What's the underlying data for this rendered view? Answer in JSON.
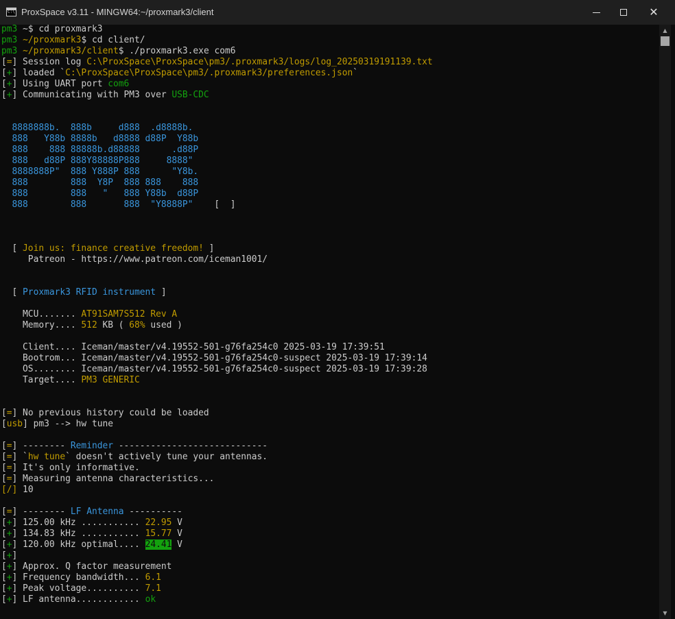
{
  "window": {
    "title": "ProxSpace v3.11 - MINGW64:~/proxmark3/client",
    "icon": "console-icon"
  },
  "colors": {
    "default": "#cccccc",
    "green": "#13a10e",
    "yellow": "#c19c00",
    "blue": "#3a96dd",
    "highlight_bg": "#13a10e",
    "highlight_fg": "#0c0c0c"
  },
  "terminal": {
    "lines": [
      {
        "row": 0,
        "segments": [
          {
            "t": "pm3",
            "c": "green"
          },
          {
            "t": " ~$ cd proxmark3",
            "c": "default"
          }
        ]
      },
      {
        "row": 1,
        "segments": [
          {
            "t": "pm3",
            "c": "green"
          },
          {
            "t": " ",
            "c": "default"
          },
          {
            "t": "~/proxmark3",
            "c": "yellow"
          },
          {
            "t": "$ cd client/",
            "c": "default"
          }
        ]
      },
      {
        "row": 2,
        "segments": [
          {
            "t": "pm3",
            "c": "green"
          },
          {
            "t": " ",
            "c": "default"
          },
          {
            "t": "~/proxmark3/client",
            "c": "yellow"
          },
          {
            "t": "$ ./proxmark3.exe com6",
            "c": "default"
          }
        ]
      },
      {
        "row": 3,
        "segments": [
          {
            "t": "[",
            "c": "default"
          },
          {
            "t": "=",
            "c": "yellow"
          },
          {
            "t": "] Session log ",
            "c": "default"
          },
          {
            "t": "C:\\ProxSpace\\ProxSpace\\pm3/.proxmark3/logs/log_20250319191139.txt",
            "c": "yellow"
          }
        ]
      },
      {
        "row": 4,
        "segments": [
          {
            "t": "[",
            "c": "default"
          },
          {
            "t": "+",
            "c": "green"
          },
          {
            "t": "] loaded `",
            "c": "default"
          },
          {
            "t": "C:\\ProxSpace\\ProxSpace\\pm3/.proxmark3/preferences.json",
            "c": "yellow"
          },
          {
            "t": "`",
            "c": "default"
          }
        ]
      },
      {
        "row": 5,
        "segments": [
          {
            "t": "[",
            "c": "default"
          },
          {
            "t": "+",
            "c": "green"
          },
          {
            "t": "] Using UART port ",
            "c": "default"
          },
          {
            "t": "com6",
            "c": "green"
          }
        ]
      },
      {
        "row": 6,
        "segments": [
          {
            "t": "[",
            "c": "default"
          },
          {
            "t": "+",
            "c": "green"
          },
          {
            "t": "] Communicating with PM3 over ",
            "c": "default"
          },
          {
            "t": "USB-CDC",
            "c": "green"
          }
        ]
      },
      {
        "row": 9,
        "segments": [
          {
            "t": "  8888888b.  888b     d888  .d8888b.",
            "c": "blue"
          }
        ]
      },
      {
        "row": 10,
        "segments": [
          {
            "t": "  888   Y88b 8888b   d8888 d88P  Y88b",
            "c": "blue"
          }
        ]
      },
      {
        "row": 11,
        "segments": [
          {
            "t": "  888    888 88888b.d88888      .d88P",
            "c": "blue"
          }
        ]
      },
      {
        "row": 12,
        "segments": [
          {
            "t": "  888   d88P 888Y88888P888     8888\"",
            "c": "blue"
          }
        ]
      },
      {
        "row": 13,
        "segments": [
          {
            "t": "  8888888P\"  888 Y888P 888      \"Y8b.",
            "c": "blue"
          }
        ]
      },
      {
        "row": 14,
        "segments": [
          {
            "t": "  888        888  Y8P  888 888    888",
            "c": "blue"
          }
        ]
      },
      {
        "row": 15,
        "segments": [
          {
            "t": "  888        888   \"   888 Y88b  d88P",
            "c": "blue"
          }
        ]
      },
      {
        "row": 16,
        "segments": [
          {
            "t": "  888        888       888  \"Y8888P\"",
            "c": "blue"
          },
          {
            "t": "    [  ]",
            "c": "default"
          }
        ]
      },
      {
        "row": 20,
        "segments": [
          {
            "t": "  [ ",
            "c": "default"
          },
          {
            "t": "Join us: finance creative freedom!",
            "c": "yellow"
          },
          {
            "t": " ]",
            "c": "default"
          }
        ]
      },
      {
        "row": 21,
        "segments": [
          {
            "t": "     Patreon - https://www.patreon.com/iceman1001/",
            "c": "default"
          }
        ]
      },
      {
        "row": 24,
        "segments": [
          {
            "t": "  [ ",
            "c": "default"
          },
          {
            "t": "Proxmark3 RFID instrument",
            "c": "blue"
          },
          {
            "t": " ]",
            "c": "default"
          }
        ]
      },
      {
        "row": 26,
        "segments": [
          {
            "t": "    MCU....... ",
            "c": "default"
          },
          {
            "t": "AT91SAM7S512 Rev A",
            "c": "yellow"
          }
        ]
      },
      {
        "row": 27,
        "segments": [
          {
            "t": "    Memory.... ",
            "c": "default"
          },
          {
            "t": "512",
            "c": "yellow"
          },
          {
            "t": " KB ( ",
            "c": "default"
          },
          {
            "t": "68%",
            "c": "yellow"
          },
          {
            "t": " used )",
            "c": "default"
          }
        ]
      },
      {
        "row": 29,
        "segments": [
          {
            "t": "    Client.... Iceman/master/v4.19552-501-g76fa254c0 2025-03-19 17:39:51",
            "c": "default"
          }
        ]
      },
      {
        "row": 30,
        "segments": [
          {
            "t": "    Bootrom... Iceman/master/v4.19552-501-g76fa254c0-suspect 2025-03-19 17:39:14",
            "c": "default"
          }
        ]
      },
      {
        "row": 31,
        "segments": [
          {
            "t": "    OS........ Iceman/master/v4.19552-501-g76fa254c0-suspect 2025-03-19 17:39:28",
            "c": "default"
          }
        ]
      },
      {
        "row": 32,
        "segments": [
          {
            "t": "    Target.... ",
            "c": "default"
          },
          {
            "t": "PM3 GENERIC",
            "c": "yellow"
          }
        ]
      },
      {
        "row": 35,
        "segments": [
          {
            "t": "[",
            "c": "default"
          },
          {
            "t": "=",
            "c": "yellow"
          },
          {
            "t": "] No previous history could be loaded",
            "c": "default"
          }
        ]
      },
      {
        "row": 36,
        "segments": [
          {
            "t": "[",
            "c": "default"
          },
          {
            "t": "usb",
            "c": "yellow"
          },
          {
            "t": "] pm3 --> hw tune",
            "c": "default"
          }
        ]
      },
      {
        "row": 38,
        "segments": [
          {
            "t": "[",
            "c": "default"
          },
          {
            "t": "=",
            "c": "yellow"
          },
          {
            "t": "] -------- ",
            "c": "default"
          },
          {
            "t": "Reminder",
            "c": "blue"
          },
          {
            "t": " ----------------------------",
            "c": "default"
          }
        ]
      },
      {
        "row": 39,
        "segments": [
          {
            "t": "[",
            "c": "default"
          },
          {
            "t": "=",
            "c": "yellow"
          },
          {
            "t": "] `",
            "c": "default"
          },
          {
            "t": "hw tune",
            "c": "yellow"
          },
          {
            "t": "` doesn't actively tune your antennas.",
            "c": "default"
          }
        ]
      },
      {
        "row": 40,
        "segments": [
          {
            "t": "[",
            "c": "default"
          },
          {
            "t": "=",
            "c": "yellow"
          },
          {
            "t": "] It's only informative.",
            "c": "default"
          }
        ]
      },
      {
        "row": 41,
        "segments": [
          {
            "t": "[",
            "c": "default"
          },
          {
            "t": "=",
            "c": "yellow"
          },
          {
            "t": "] Measuring antenna characteristics...",
            "c": "default"
          }
        ]
      },
      {
        "row": 42,
        "segments": [
          {
            "t": "[/]",
            "c": "yellow"
          },
          {
            "t": " 10",
            "c": "default"
          }
        ]
      },
      {
        "row": 44,
        "segments": [
          {
            "t": "[",
            "c": "default"
          },
          {
            "t": "=",
            "c": "yellow"
          },
          {
            "t": "] -------- ",
            "c": "default"
          },
          {
            "t": "LF Antenna",
            "c": "blue"
          },
          {
            "t": " ----------",
            "c": "default"
          }
        ]
      },
      {
        "row": 45,
        "segments": [
          {
            "t": "[",
            "c": "default"
          },
          {
            "t": "+",
            "c": "green"
          },
          {
            "t": "] 125.00 kHz ........... ",
            "c": "default"
          },
          {
            "t": "22.95",
            "c": "yellow"
          },
          {
            "t": " V",
            "c": "default"
          }
        ]
      },
      {
        "row": 46,
        "segments": [
          {
            "t": "[",
            "c": "default"
          },
          {
            "t": "+",
            "c": "green"
          },
          {
            "t": "] 134.83 kHz ........... ",
            "c": "default"
          },
          {
            "t": "15.77",
            "c": "yellow"
          },
          {
            "t": " V",
            "c": "default"
          }
        ]
      },
      {
        "row": 47,
        "segments": [
          {
            "t": "[",
            "c": "default"
          },
          {
            "t": "+",
            "c": "green"
          },
          {
            "t": "] 120.00 kHz optimal.... ",
            "c": "default"
          },
          {
            "t": "24.41",
            "c": "highlight"
          },
          {
            "t": " V",
            "c": "default"
          }
        ]
      },
      {
        "row": 48,
        "segments": [
          {
            "t": "[",
            "c": "default"
          },
          {
            "t": "+",
            "c": "green"
          },
          {
            "t": "]",
            "c": "default"
          }
        ]
      },
      {
        "row": 49,
        "segments": [
          {
            "t": "[",
            "c": "default"
          },
          {
            "t": "+",
            "c": "green"
          },
          {
            "t": "] Approx. Q factor measurement",
            "c": "default"
          }
        ]
      },
      {
        "row": 50,
        "segments": [
          {
            "t": "[",
            "c": "default"
          },
          {
            "t": "+",
            "c": "green"
          },
          {
            "t": "] Frequency bandwidth... ",
            "c": "default"
          },
          {
            "t": "6.1",
            "c": "yellow"
          }
        ]
      },
      {
        "row": 51,
        "segments": [
          {
            "t": "[",
            "c": "default"
          },
          {
            "t": "+",
            "c": "green"
          },
          {
            "t": "] Peak voltage.......... ",
            "c": "default"
          },
          {
            "t": "7.1",
            "c": "yellow"
          }
        ]
      },
      {
        "row": 52,
        "segments": [
          {
            "t": "[",
            "c": "default"
          },
          {
            "t": "+",
            "c": "green"
          },
          {
            "t": "] LF antenna............ ",
            "c": "default"
          },
          {
            "t": "ok",
            "c": "green"
          }
        ]
      }
    ]
  },
  "scrollbar": {
    "up_icon": "scroll-up-arrow-icon",
    "down_icon": "scroll-down-arrow-icon",
    "up_glyph": "▲",
    "down_glyph": "▼"
  },
  "controls": {
    "minimize_icon": "minimize-icon",
    "maximize_icon": "maximize-icon",
    "close_icon": "close-icon",
    "close_glyph": "✕"
  }
}
